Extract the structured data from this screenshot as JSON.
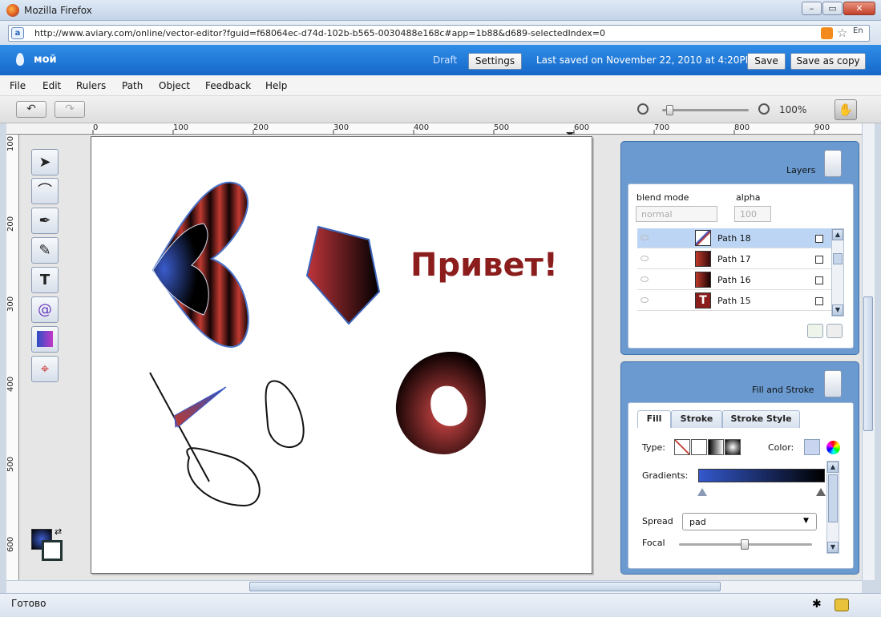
{
  "window": {
    "title": "Mozilla Firefox"
  },
  "browser": {
    "url": "http://www.aviary.com/online/vector-editor?fguid=f68064ec-d74d-102b-b565-0030488e168c#app=1b88&d689-selectedIndex=0"
  },
  "app": {
    "doc_name": "мой",
    "status": "Draft",
    "settings_label": "Settings",
    "last_saved": "Last saved on November 22, 2010 at 4:20PM",
    "save_label": "Save",
    "save_copy_label": "Save as copy"
  },
  "menu": [
    "File",
    "Edit",
    "Rulers",
    "Path",
    "Object",
    "Feedback",
    "Help"
  ],
  "toolbar": {
    "zoom": "100%"
  },
  "rulers": {
    "h_ticks": [
      "0",
      "100",
      "200",
      "300",
      "400",
      "500",
      "600",
      "700",
      "800",
      "900"
    ],
    "v_ticks": [
      "100",
      "200",
      "300",
      "400",
      "500",
      "600"
    ]
  },
  "canvas": {
    "text": "Привет!"
  },
  "layers": {
    "title": "Layers",
    "blend_label": "blend mode",
    "blend_value": "normal",
    "alpha_label": "alpha",
    "alpha_value": "100",
    "items": [
      {
        "name": "Path 18",
        "selected": true
      },
      {
        "name": "Path 17",
        "selected": false
      },
      {
        "name": "Path 16",
        "selected": false
      },
      {
        "name": "Path 15",
        "selected": false
      }
    ]
  },
  "fill_stroke": {
    "title": "Fill and Stroke",
    "tabs": [
      "Fill",
      "Stroke",
      "Stroke Style"
    ],
    "type_label": "Type:",
    "color_label": "Color:",
    "gradients_label": "Gradients:",
    "spread_label": "Spread",
    "spread_value": "pad",
    "focal_label": "Focal"
  },
  "status_bar": {
    "text": "Готово"
  }
}
